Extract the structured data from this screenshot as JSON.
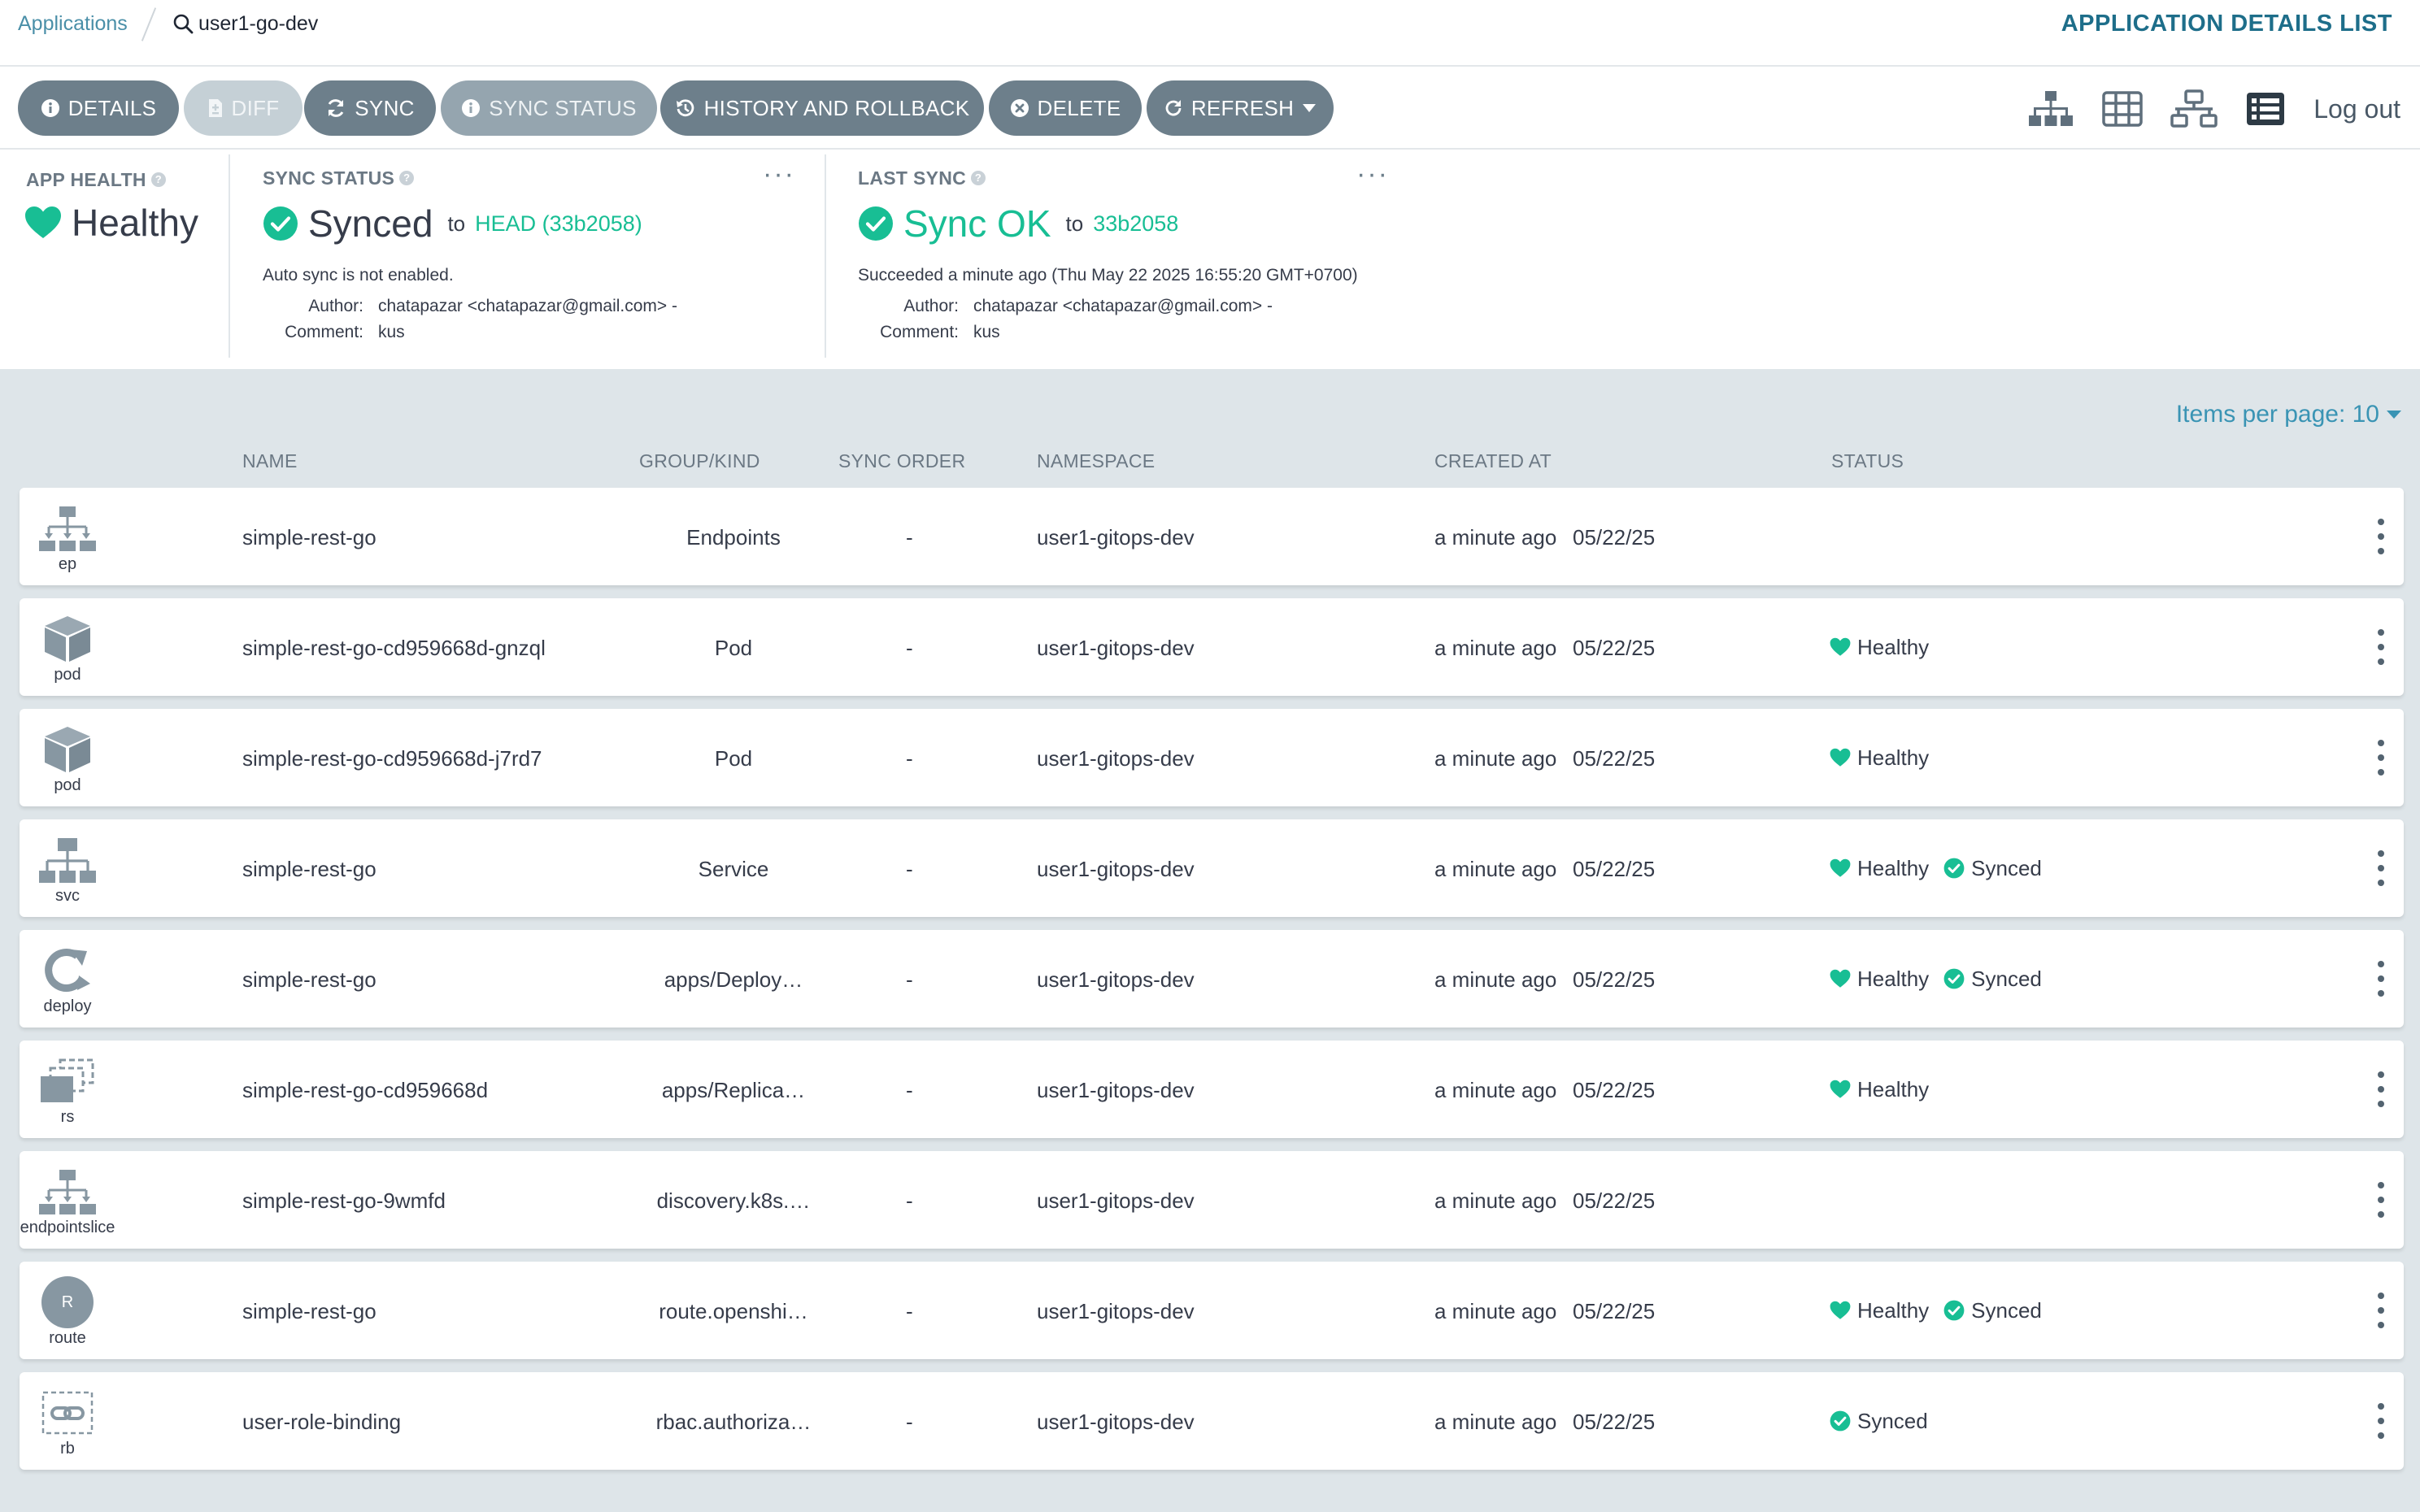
{
  "breadcrumb": {
    "applications_label": "Applications",
    "search_value": "user1-go-dev"
  },
  "page_heading": "APPLICATION DETAILS LIST",
  "toolbar": {
    "details": "DETAILS",
    "diff": "DIFF",
    "sync": "SYNC",
    "sync_status": "SYNC STATUS",
    "history": "HISTORY AND ROLLBACK",
    "delete": "DELETE",
    "refresh": "REFRESH",
    "logout": "Log out"
  },
  "app_health": {
    "label": "APP HEALTH",
    "value": "Healthy"
  },
  "sync_status": {
    "label": "SYNC STATUS",
    "value": "Synced",
    "to": "to",
    "revision": "HEAD (33b2058)",
    "auto_sync_note": "Auto sync is not enabled.",
    "author_key": "Author:",
    "author": "chatapazar <chatapazar@gmail.com> -",
    "comment_key": "Comment:",
    "comment": "kus"
  },
  "last_sync": {
    "label": "LAST SYNC",
    "value": "Sync OK",
    "to": "to",
    "revision": "33b2058",
    "succeeded": "Succeeded a minute ago (Thu May 22 2025 16:55:20 GMT+0700)",
    "author_key": "Author:",
    "author": "chatapazar <chatapazar@gmail.com> -",
    "comment_key": "Comment:",
    "comment": "kus"
  },
  "list": {
    "items_per_page": "Items per page: 10",
    "columns": {
      "name": "NAME",
      "group_kind": "GROUP/KIND",
      "sync_order": "SYNC ORDER",
      "namespace": "NAMESPACE",
      "created_at": "CREATED AT",
      "status": "STATUS"
    },
    "rows": [
      {
        "icon": "endpoints-icon",
        "kind_short": "ep",
        "name": "simple-rest-go",
        "group_kind": "Endpoints",
        "sync_order": "-",
        "namespace": "user1-gitops-dev",
        "created_rel": "a minute ago",
        "created_date": "05/22/25",
        "health": "",
        "sync": ""
      },
      {
        "icon": "pod-icon",
        "kind_short": "pod",
        "name": "simple-rest-go-cd959668d-gnzql",
        "group_kind": "Pod",
        "sync_order": "-",
        "namespace": "user1-gitops-dev",
        "created_rel": "a minute ago",
        "created_date": "05/22/25",
        "health": "Healthy",
        "sync": ""
      },
      {
        "icon": "pod-icon",
        "kind_short": "pod",
        "name": "simple-rest-go-cd959668d-j7rd7",
        "group_kind": "Pod",
        "sync_order": "-",
        "namespace": "user1-gitops-dev",
        "created_rel": "a minute ago",
        "created_date": "05/22/25",
        "health": "Healthy",
        "sync": ""
      },
      {
        "icon": "service-icon",
        "kind_short": "svc",
        "name": "simple-rest-go",
        "group_kind": "Service",
        "sync_order": "-",
        "namespace": "user1-gitops-dev",
        "created_rel": "a minute ago",
        "created_date": "05/22/25",
        "health": "Healthy",
        "sync": "Synced"
      },
      {
        "icon": "deployment-icon",
        "kind_short": "deploy",
        "name": "simple-rest-go",
        "group_kind": "apps/Deploy…",
        "sync_order": "-",
        "namespace": "user1-gitops-dev",
        "created_rel": "a minute ago",
        "created_date": "05/22/25",
        "health": "Healthy",
        "sync": "Synced"
      },
      {
        "icon": "replicaset-icon",
        "kind_short": "rs",
        "name": "simple-rest-go-cd959668d",
        "group_kind": "apps/Replica…",
        "sync_order": "-",
        "namespace": "user1-gitops-dev",
        "created_rel": "a minute ago",
        "created_date": "05/22/25",
        "health": "Healthy",
        "sync": ""
      },
      {
        "icon": "endpointslice-icon",
        "kind_short": "endpointslice",
        "name": "simple-rest-go-9wmfd",
        "group_kind": "discovery.k8s.…",
        "sync_order": "-",
        "namespace": "user1-gitops-dev",
        "created_rel": "a minute ago",
        "created_date": "05/22/25",
        "health": "",
        "sync": ""
      },
      {
        "icon": "route-icon",
        "kind_short": "route",
        "badge_letter": "R",
        "name": "simple-rest-go",
        "group_kind": "route.openshi…",
        "sync_order": "-",
        "namespace": "user1-gitops-dev",
        "created_rel": "a minute ago",
        "created_date": "05/22/25",
        "health": "Healthy",
        "sync": "Synced"
      },
      {
        "icon": "rolebinding-icon",
        "kind_short": "rb",
        "name": "user-role-binding",
        "group_kind": "rbac.authoriza…",
        "sync_order": "-",
        "namespace": "user1-gitops-dev",
        "created_rel": "a minute ago",
        "created_date": "05/22/25",
        "health": "",
        "sync": "Synced"
      }
    ]
  },
  "colors": {
    "accent": "#18be94",
    "link": "#4a8fa8",
    "button": "#6d7f8b",
    "list_bg": "#dee5e9"
  }
}
